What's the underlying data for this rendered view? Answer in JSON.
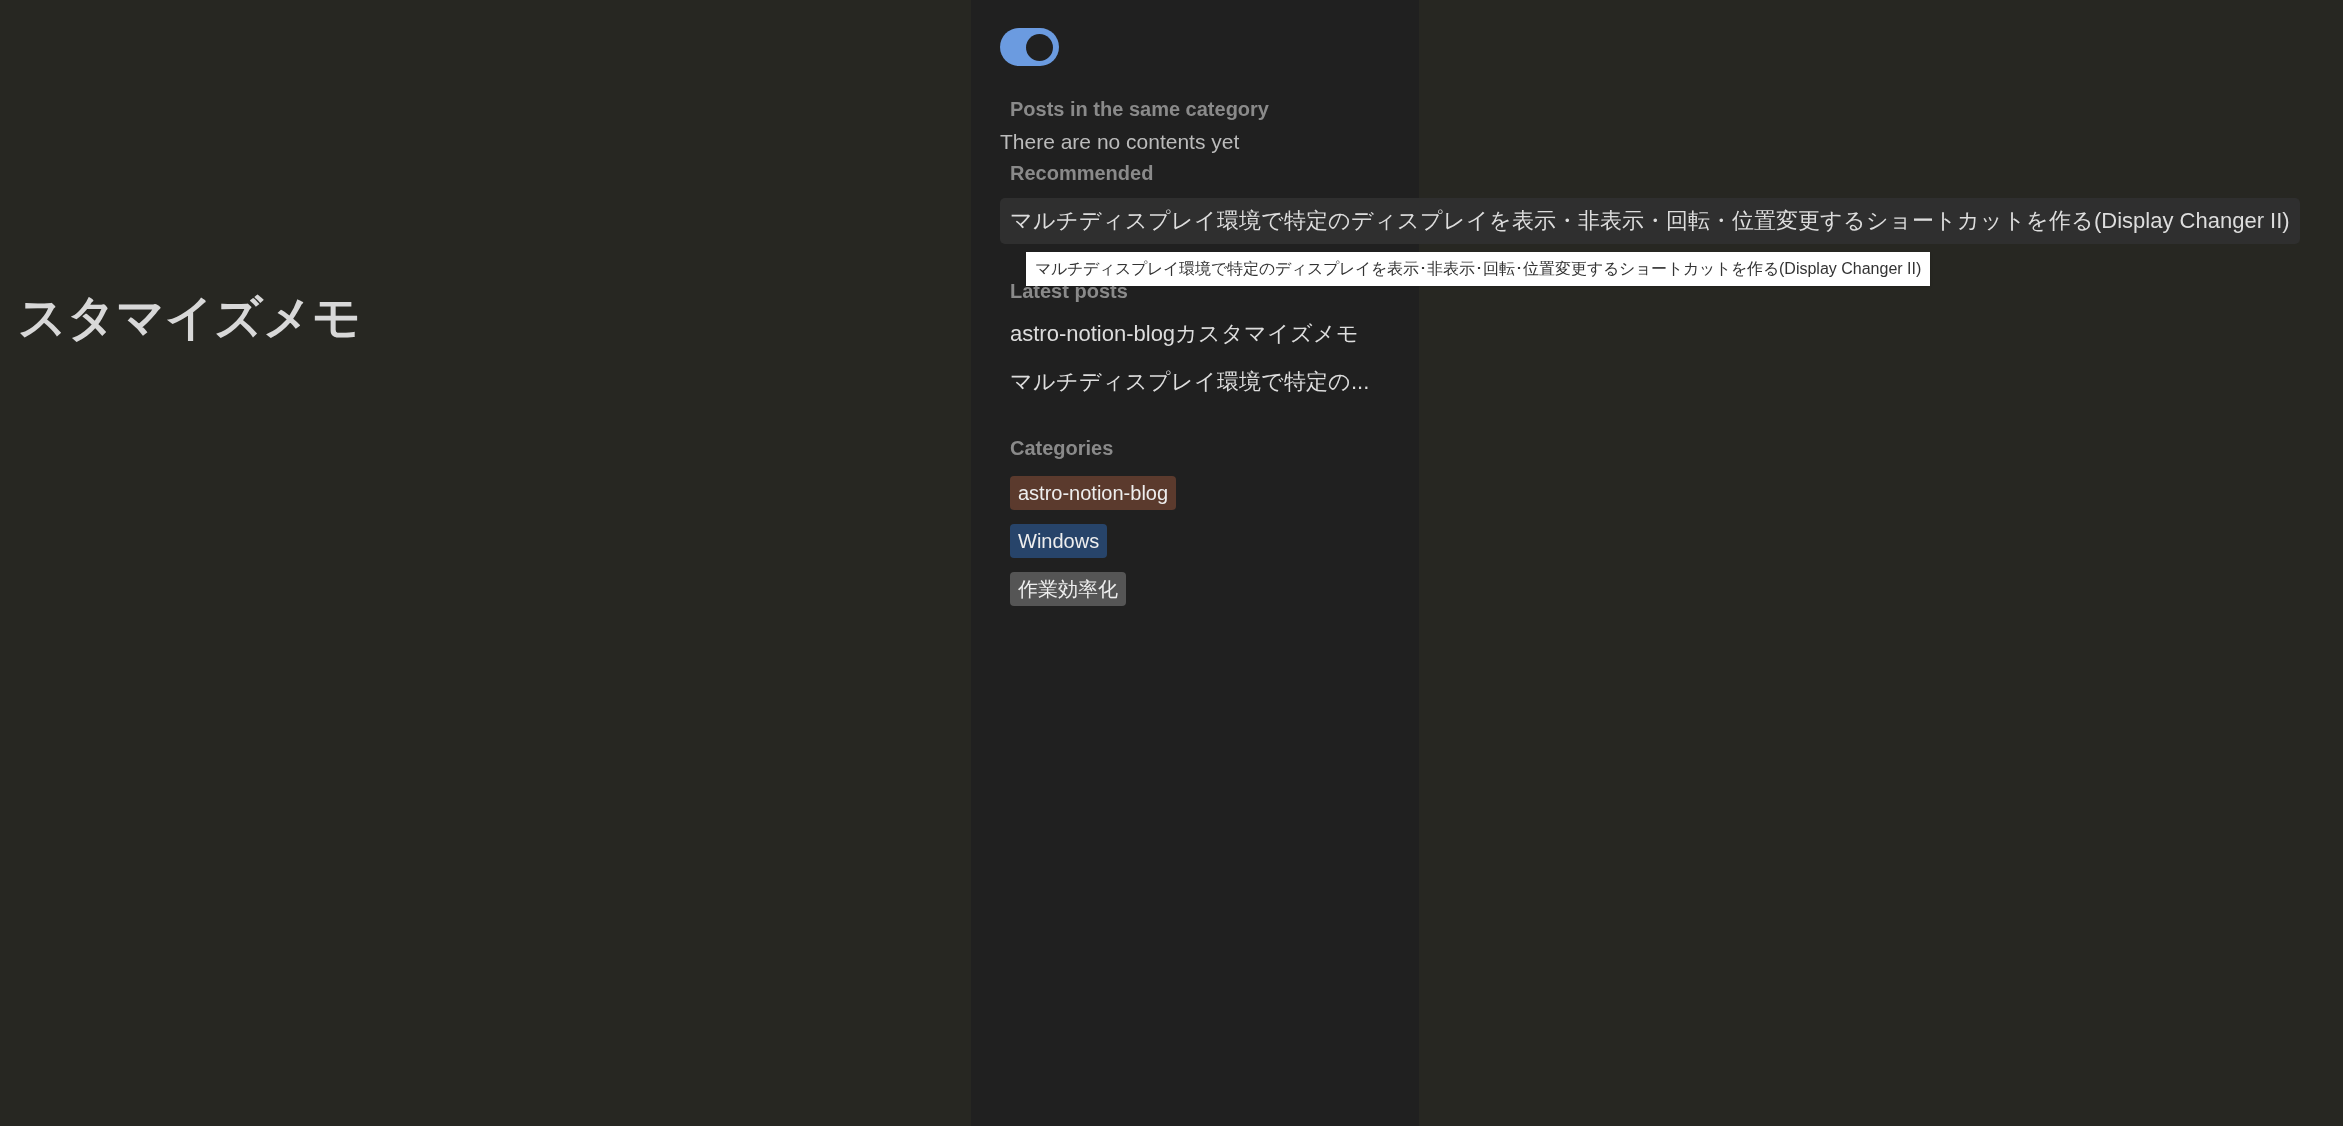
{
  "main": {
    "title": "スタマイズメモ"
  },
  "sidebar": {
    "toggle": {
      "on": true
    },
    "same_category": {
      "heading": "Posts in the same category",
      "empty_text": "There are no contents yet"
    },
    "recommended": {
      "heading": "Recommended",
      "items": [
        {
          "title": "マルチディスプレイ環境で特定のディスプレイを表示・非表示・回転・位置変更するショートカットを作る(Display Changer II)",
          "hovered": true
        }
      ]
    },
    "tooltip": "マルチディスプレイ環境で特定のディスプレイを表示･非表示･回転･位置変更するショートカットを作る(Display Changer II)",
    "latest": {
      "heading": "Latest posts",
      "items": [
        "astro-notion-blogカスタマイズメモ",
        "マルチディスプレイ環境で特定の..."
      ]
    },
    "categories": {
      "heading": "Categories",
      "items": [
        {
          "label": "astro-notion-blog",
          "color": "#5b3a2d"
        },
        {
          "label": "Windows",
          "color": "#27446a"
        },
        {
          "label": "作業効率化",
          "color": "#555555"
        }
      ]
    }
  }
}
